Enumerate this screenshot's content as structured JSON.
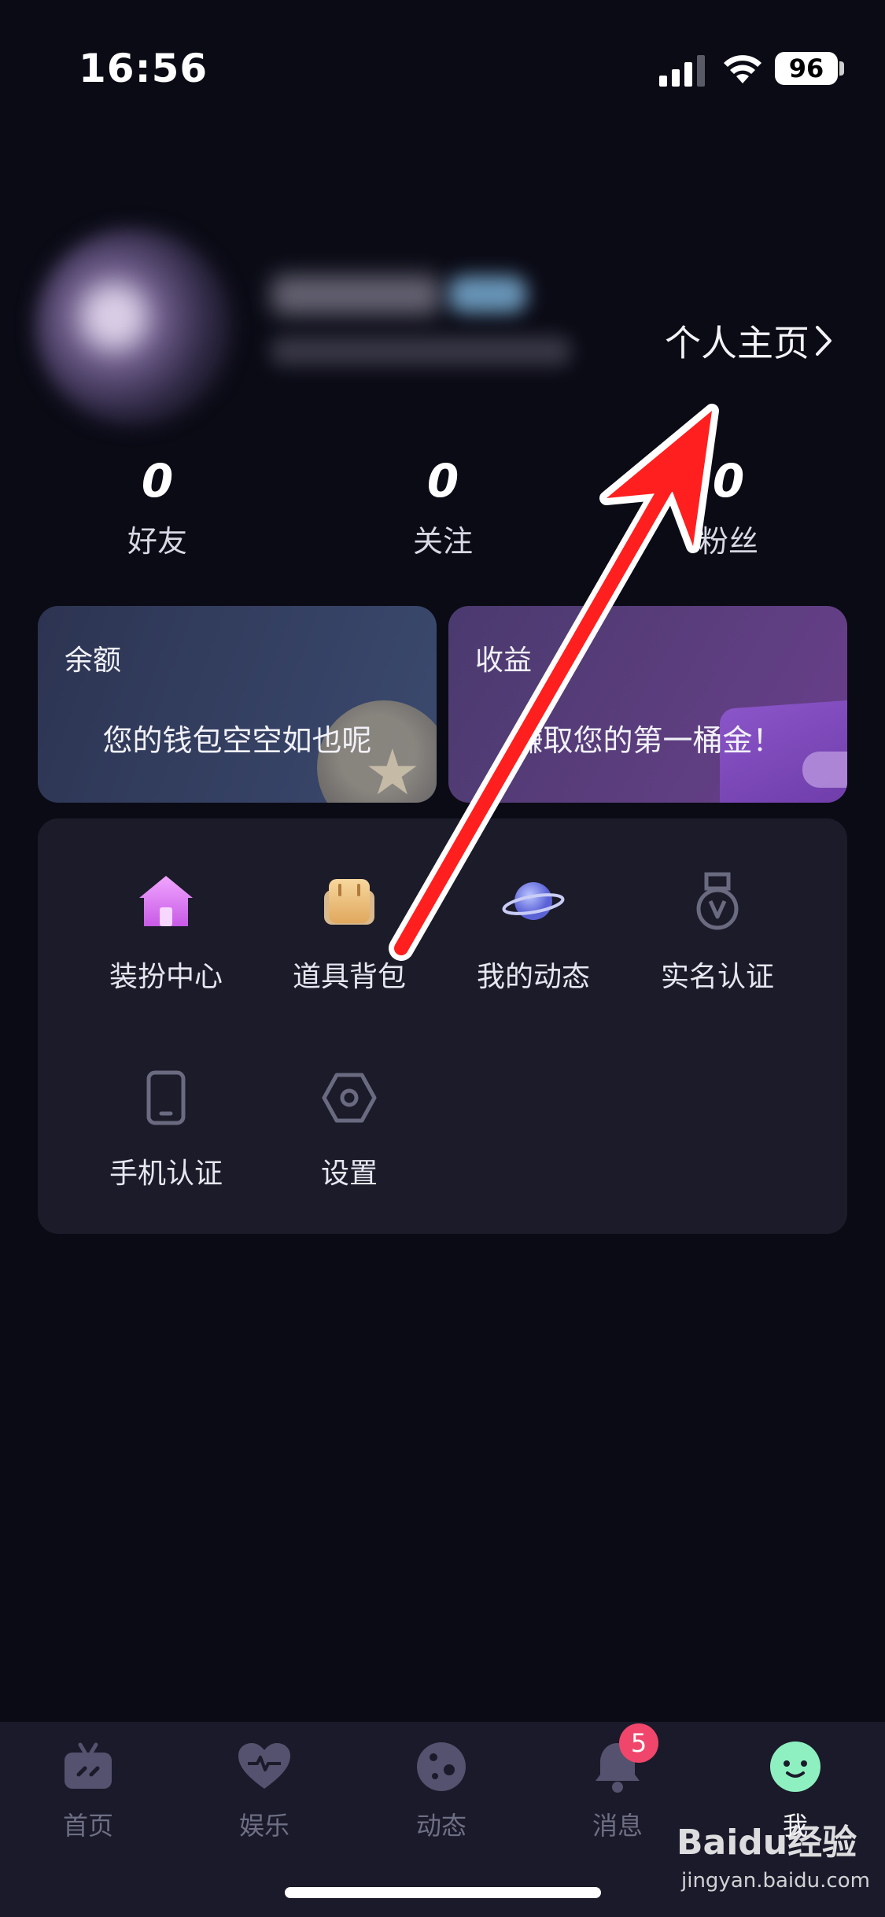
{
  "status_bar": {
    "time": "16:56",
    "battery": "96"
  },
  "profile": {
    "link_label": "个人主页"
  },
  "stats": [
    {
      "value": "0",
      "label": "好友"
    },
    {
      "value": "0",
      "label": "关注"
    },
    {
      "value": "0",
      "label": "粉丝"
    }
  ],
  "cards": {
    "balance": {
      "title": "余额",
      "message": "您的钱包空空如也呢"
    },
    "income": {
      "title": "收益",
      "message": "赚取您的第一桶金！"
    }
  },
  "tools": [
    {
      "label": "装扮中心",
      "icon": "house-icon"
    },
    {
      "label": "道具背包",
      "icon": "backpack-icon"
    },
    {
      "label": "我的动态",
      "icon": "planet-icon"
    },
    {
      "label": "实名认证",
      "icon": "medal-icon"
    },
    {
      "label": "手机认证",
      "icon": "phone-icon"
    },
    {
      "label": "设置",
      "icon": "hexagon-settings-icon"
    }
  ],
  "bottom_nav": [
    {
      "label": "首页",
      "icon": "tv-icon"
    },
    {
      "label": "娱乐",
      "icon": "heart-pulse-icon"
    },
    {
      "label": "动态",
      "icon": "planet-dots-icon"
    },
    {
      "label": "消息",
      "icon": "bell-icon",
      "badge": "5"
    },
    {
      "label": "我",
      "icon": "smiley-icon",
      "active": true
    }
  ],
  "watermark": {
    "brand": "Baidu经验",
    "url": "jingyan.baidu.com"
  },
  "colors": {
    "accent_active": "#8ef0c0",
    "badge": "#f0466b",
    "annotation_arrow": "#ff1f1f"
  }
}
